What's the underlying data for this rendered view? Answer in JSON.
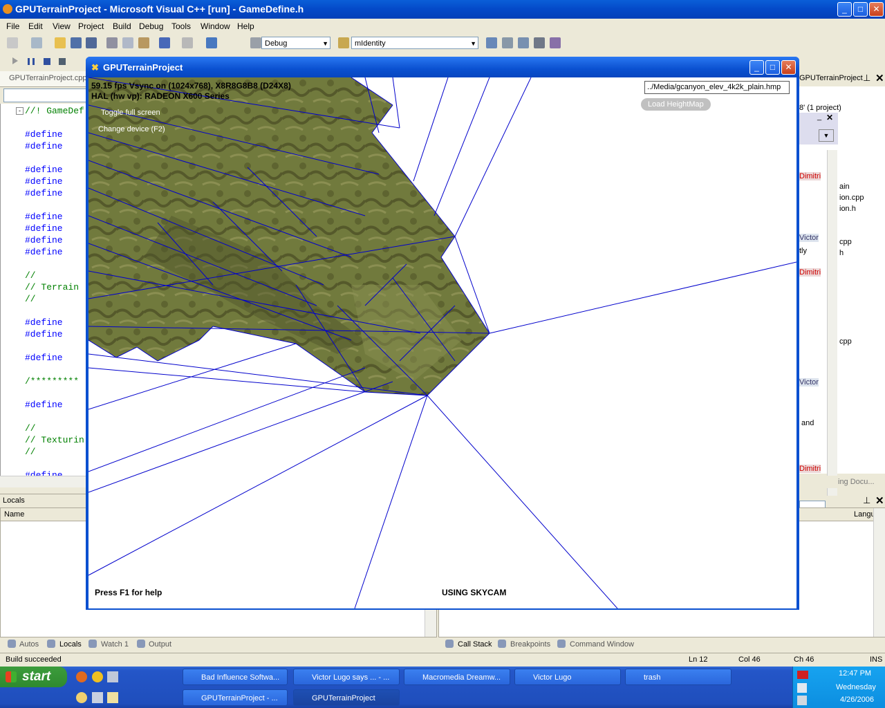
{
  "window": {
    "title": "GPUTerrainProject - Microsoft Visual C++ [run] - GameDefine.h",
    "controls": {
      "minimize": "_",
      "maximize": "□",
      "close": "✕"
    }
  },
  "menu": [
    "File",
    "Edit",
    "View",
    "Project",
    "Build",
    "Debug",
    "Tools",
    "Window",
    "Help"
  ],
  "toolbar": {
    "config": "Debug",
    "find_value": "mIdentity"
  },
  "editor": {
    "tab": "GPUTerrainProject.cpp",
    "lines": [
      {
        "text": "//! GameDef",
        "type": "cm"
      },
      {
        "text": "#define",
        "type": "kw"
      },
      {
        "text": "#define",
        "type": "kw"
      },
      {
        "text": "#define",
        "type": "kw"
      },
      {
        "text": "#define",
        "type": "kw"
      },
      {
        "text": "#define",
        "type": "kw"
      },
      {
        "text": "#define",
        "type": "kw"
      },
      {
        "text": "#define",
        "type": "kw"
      },
      {
        "text": "#define",
        "type": "kw"
      },
      {
        "text": "#define",
        "type": "kw"
      },
      {
        "text": "//",
        "type": "cm"
      },
      {
        "text": "// Terrain",
        "type": "cm"
      },
      {
        "text": "//",
        "type": "cm"
      },
      {
        "text": "#define",
        "type": "kw"
      },
      {
        "text": "#define",
        "type": "kw"
      },
      {
        "text": "#define",
        "type": "kw"
      },
      {
        "text": "/*********",
        "type": "cm"
      },
      {
        "text": "#define",
        "type": "kw"
      },
      {
        "text": "//",
        "type": "cm"
      },
      {
        "text": "// Texturin",
        "type": "cm"
      },
      {
        "text": "//",
        "type": "cm"
      },
      {
        "text": "#define",
        "type": "kw"
      }
    ]
  },
  "right_panel": {
    "tab": "GPUTerrainProject",
    "solution_line": "8' (1 project)",
    "items": [
      "Dimitri",
      "ain",
      "ion.cpp",
      "ion.h",
      "Victor",
      "cpp",
      "h",
      "tly",
      "Dimitri",
      "cpp",
      "Victor",
      "and",
      "Dimitri"
    ],
    "footer": "ing Docu..."
  },
  "app": {
    "title": "GPUTerrainProject",
    "stats_line1": "59.15 fps Vsync on (1024x768), X8R8G8B8 (D24X8)",
    "stats_line2": "HAL (hw vp): RADEON X600 Series",
    "toggle_fullscreen": "Toggle full screen",
    "change_device": "Change device (F2)",
    "heightmap_path": "../Media/gcanyon_elev_4k2k_plain.hmp",
    "load_button": "Load HeightMap",
    "help_text": "Press F1 for help",
    "camera_text": "USING SKYCAM"
  },
  "bottom_left": {
    "title": "Locals",
    "column": "Name",
    "tabs": [
      "Autos",
      "Locals",
      "Watch 1",
      "Output"
    ]
  },
  "bottom_right": {
    "column": "Langu",
    "tabs": [
      "Call Stack",
      "Breakpoints",
      "Command Window"
    ]
  },
  "status": {
    "message": "Build succeeded",
    "ln": "Ln 12",
    "col": "Col 46",
    "ch": "Ch 46",
    "ins": "INS"
  },
  "taskbar": {
    "start": "start",
    "row1": [
      "Bad Influence Softwa...",
      "Victor Lugo says ... - ...",
      "Macromedia Dreamw...",
      "Victor Lugo",
      "trash"
    ],
    "row2": [
      "GPUTerrainProject - ...",
      "GPUTerrainProject"
    ],
    "time": "12:47 PM",
    "day": "Wednesday",
    "date": "4/26/2006"
  },
  "colors": {
    "xp_blue": "#0a50d0",
    "wire": "#0000cc",
    "terrain": "#6f7a3c"
  }
}
